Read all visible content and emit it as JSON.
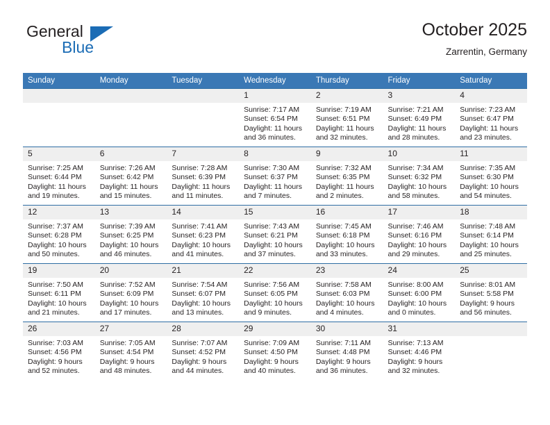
{
  "brand": {
    "name_part1": "General",
    "name_part2": "Blue",
    "logo_icon": "triangle-flag-icon",
    "accent_color": "#1b6cb5"
  },
  "header": {
    "title": "October 2025",
    "subtitle": "Zarrentin, Germany"
  },
  "calendar": {
    "header_bg": "#3a78b5",
    "daynum_bg": "#efefef",
    "border_color": "#2e6da4",
    "weekdays": [
      "Sunday",
      "Monday",
      "Tuesday",
      "Wednesday",
      "Thursday",
      "Friday",
      "Saturday"
    ],
    "weeks": [
      [
        {
          "day": "",
          "sunrise": "",
          "sunset": "",
          "daylight_line1": "",
          "daylight_line2": ""
        },
        {
          "day": "",
          "sunrise": "",
          "sunset": "",
          "daylight_line1": "",
          "daylight_line2": ""
        },
        {
          "day": "",
          "sunrise": "",
          "sunset": "",
          "daylight_line1": "",
          "daylight_line2": ""
        },
        {
          "day": "1",
          "sunrise": "Sunrise: 7:17 AM",
          "sunset": "Sunset: 6:54 PM",
          "daylight_line1": "Daylight: 11 hours",
          "daylight_line2": "and 36 minutes."
        },
        {
          "day": "2",
          "sunrise": "Sunrise: 7:19 AM",
          "sunset": "Sunset: 6:51 PM",
          "daylight_line1": "Daylight: 11 hours",
          "daylight_line2": "and 32 minutes."
        },
        {
          "day": "3",
          "sunrise": "Sunrise: 7:21 AM",
          "sunset": "Sunset: 6:49 PM",
          "daylight_line1": "Daylight: 11 hours",
          "daylight_line2": "and 28 minutes."
        },
        {
          "day": "4",
          "sunrise": "Sunrise: 7:23 AM",
          "sunset": "Sunset: 6:47 PM",
          "daylight_line1": "Daylight: 11 hours",
          "daylight_line2": "and 23 minutes."
        }
      ],
      [
        {
          "day": "5",
          "sunrise": "Sunrise: 7:25 AM",
          "sunset": "Sunset: 6:44 PM",
          "daylight_line1": "Daylight: 11 hours",
          "daylight_line2": "and 19 minutes."
        },
        {
          "day": "6",
          "sunrise": "Sunrise: 7:26 AM",
          "sunset": "Sunset: 6:42 PM",
          "daylight_line1": "Daylight: 11 hours",
          "daylight_line2": "and 15 minutes."
        },
        {
          "day": "7",
          "sunrise": "Sunrise: 7:28 AM",
          "sunset": "Sunset: 6:39 PM",
          "daylight_line1": "Daylight: 11 hours",
          "daylight_line2": "and 11 minutes."
        },
        {
          "day": "8",
          "sunrise": "Sunrise: 7:30 AM",
          "sunset": "Sunset: 6:37 PM",
          "daylight_line1": "Daylight: 11 hours",
          "daylight_line2": "and 7 minutes."
        },
        {
          "day": "9",
          "sunrise": "Sunrise: 7:32 AM",
          "sunset": "Sunset: 6:35 PM",
          "daylight_line1": "Daylight: 11 hours",
          "daylight_line2": "and 2 minutes."
        },
        {
          "day": "10",
          "sunrise": "Sunrise: 7:34 AM",
          "sunset": "Sunset: 6:32 PM",
          "daylight_line1": "Daylight: 10 hours",
          "daylight_line2": "and 58 minutes."
        },
        {
          "day": "11",
          "sunrise": "Sunrise: 7:35 AM",
          "sunset": "Sunset: 6:30 PM",
          "daylight_line1": "Daylight: 10 hours",
          "daylight_line2": "and 54 minutes."
        }
      ],
      [
        {
          "day": "12",
          "sunrise": "Sunrise: 7:37 AM",
          "sunset": "Sunset: 6:28 PM",
          "daylight_line1": "Daylight: 10 hours",
          "daylight_line2": "and 50 minutes."
        },
        {
          "day": "13",
          "sunrise": "Sunrise: 7:39 AM",
          "sunset": "Sunset: 6:25 PM",
          "daylight_line1": "Daylight: 10 hours",
          "daylight_line2": "and 46 minutes."
        },
        {
          "day": "14",
          "sunrise": "Sunrise: 7:41 AM",
          "sunset": "Sunset: 6:23 PM",
          "daylight_line1": "Daylight: 10 hours",
          "daylight_line2": "and 41 minutes."
        },
        {
          "day": "15",
          "sunrise": "Sunrise: 7:43 AM",
          "sunset": "Sunset: 6:21 PM",
          "daylight_line1": "Daylight: 10 hours",
          "daylight_line2": "and 37 minutes."
        },
        {
          "day": "16",
          "sunrise": "Sunrise: 7:45 AM",
          "sunset": "Sunset: 6:18 PM",
          "daylight_line1": "Daylight: 10 hours",
          "daylight_line2": "and 33 minutes."
        },
        {
          "day": "17",
          "sunrise": "Sunrise: 7:46 AM",
          "sunset": "Sunset: 6:16 PM",
          "daylight_line1": "Daylight: 10 hours",
          "daylight_line2": "and 29 minutes."
        },
        {
          "day": "18",
          "sunrise": "Sunrise: 7:48 AM",
          "sunset": "Sunset: 6:14 PM",
          "daylight_line1": "Daylight: 10 hours",
          "daylight_line2": "and 25 minutes."
        }
      ],
      [
        {
          "day": "19",
          "sunrise": "Sunrise: 7:50 AM",
          "sunset": "Sunset: 6:11 PM",
          "daylight_line1": "Daylight: 10 hours",
          "daylight_line2": "and 21 minutes."
        },
        {
          "day": "20",
          "sunrise": "Sunrise: 7:52 AM",
          "sunset": "Sunset: 6:09 PM",
          "daylight_line1": "Daylight: 10 hours",
          "daylight_line2": "and 17 minutes."
        },
        {
          "day": "21",
          "sunrise": "Sunrise: 7:54 AM",
          "sunset": "Sunset: 6:07 PM",
          "daylight_line1": "Daylight: 10 hours",
          "daylight_line2": "and 13 minutes."
        },
        {
          "day": "22",
          "sunrise": "Sunrise: 7:56 AM",
          "sunset": "Sunset: 6:05 PM",
          "daylight_line1": "Daylight: 10 hours",
          "daylight_line2": "and 9 minutes."
        },
        {
          "day": "23",
          "sunrise": "Sunrise: 7:58 AM",
          "sunset": "Sunset: 6:03 PM",
          "daylight_line1": "Daylight: 10 hours",
          "daylight_line2": "and 4 minutes."
        },
        {
          "day": "24",
          "sunrise": "Sunrise: 8:00 AM",
          "sunset": "Sunset: 6:00 PM",
          "daylight_line1": "Daylight: 10 hours",
          "daylight_line2": "and 0 minutes."
        },
        {
          "day": "25",
          "sunrise": "Sunrise: 8:01 AM",
          "sunset": "Sunset: 5:58 PM",
          "daylight_line1": "Daylight: 9 hours",
          "daylight_line2": "and 56 minutes."
        }
      ],
      [
        {
          "day": "26",
          "sunrise": "Sunrise: 7:03 AM",
          "sunset": "Sunset: 4:56 PM",
          "daylight_line1": "Daylight: 9 hours",
          "daylight_line2": "and 52 minutes."
        },
        {
          "day": "27",
          "sunrise": "Sunrise: 7:05 AM",
          "sunset": "Sunset: 4:54 PM",
          "daylight_line1": "Daylight: 9 hours",
          "daylight_line2": "and 48 minutes."
        },
        {
          "day": "28",
          "sunrise": "Sunrise: 7:07 AM",
          "sunset": "Sunset: 4:52 PM",
          "daylight_line1": "Daylight: 9 hours",
          "daylight_line2": "and 44 minutes."
        },
        {
          "day": "29",
          "sunrise": "Sunrise: 7:09 AM",
          "sunset": "Sunset: 4:50 PM",
          "daylight_line1": "Daylight: 9 hours",
          "daylight_line2": "and 40 minutes."
        },
        {
          "day": "30",
          "sunrise": "Sunrise: 7:11 AM",
          "sunset": "Sunset: 4:48 PM",
          "daylight_line1": "Daylight: 9 hours",
          "daylight_line2": "and 36 minutes."
        },
        {
          "day": "31",
          "sunrise": "Sunrise: 7:13 AM",
          "sunset": "Sunset: 4:46 PM",
          "daylight_line1": "Daylight: 9 hours",
          "daylight_line2": "and 32 minutes."
        },
        {
          "day": "",
          "sunrise": "",
          "sunset": "",
          "daylight_line1": "",
          "daylight_line2": ""
        }
      ]
    ]
  }
}
